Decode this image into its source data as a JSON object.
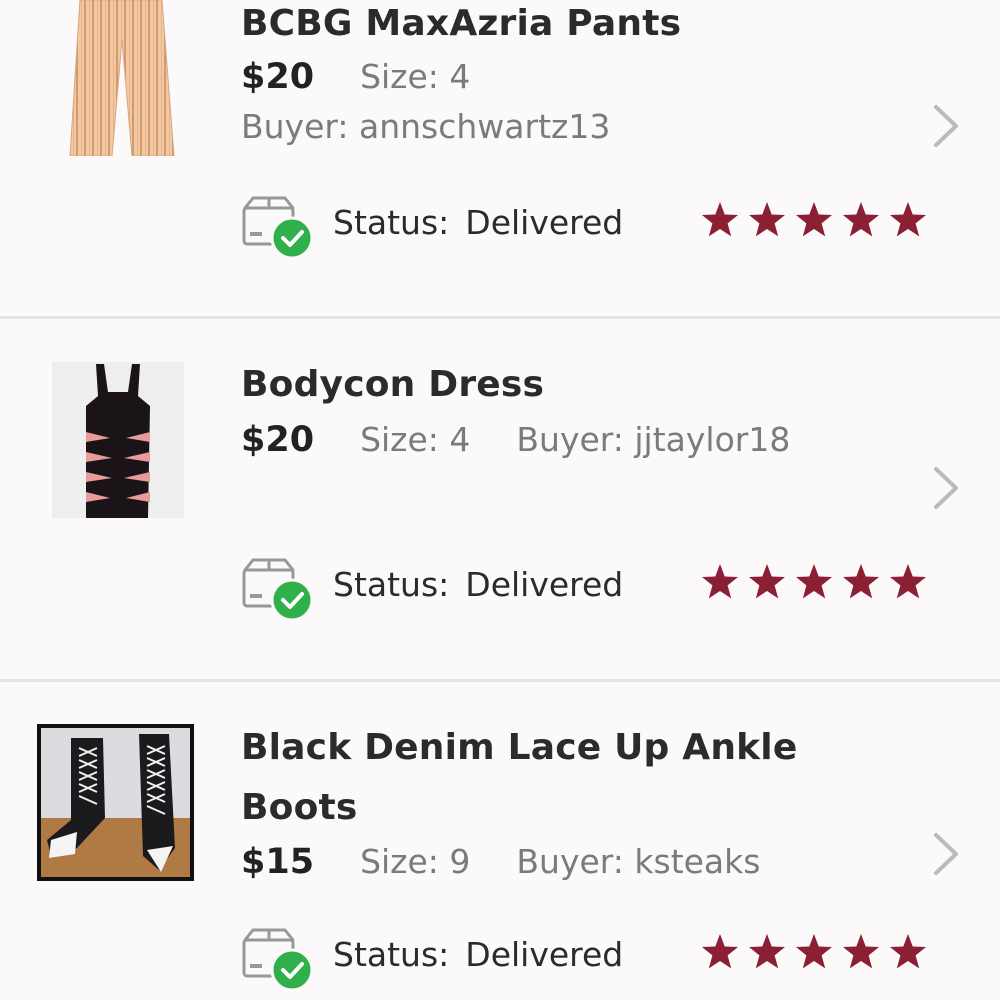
{
  "items": [
    {
      "title_lines": [
        "BCBG MaxAzria Pants"
      ],
      "price": "$20",
      "size": "Size: 4",
      "buyer": "Buyer: annschwartz13",
      "status_label": "Status:",
      "status_value": "Delivered",
      "rating": 5,
      "thumbnail": "striped-pants-photo"
    },
    {
      "title_lines": [
        "Bodycon Dress"
      ],
      "price": "$20",
      "size": "Size: 4",
      "buyer": "Buyer: jjtaylor18",
      "status_label": "Status:",
      "status_value": "Delivered",
      "rating": 5,
      "thumbnail": "black-bodycon-dress-photo"
    },
    {
      "title_lines": [
        "Black Denim Lace Up Ankle",
        "Boots"
      ],
      "price": "$15",
      "size": "Size: 9",
      "buyer": "Buyer: ksteaks",
      "status_label": "Status:",
      "status_value": "Delivered",
      "rating": 5,
      "thumbnail": "lace-up-ankle-boots-photo"
    }
  ],
  "colors": {
    "star": "#8b1f33",
    "check_badge": "#2fb04a",
    "divider": "#e6e3e5",
    "chevron": "#bdbabb"
  },
  "icons": {
    "status": "box-delivered-icon",
    "chevron": "chevron-right-icon",
    "rating": "star-icon"
  }
}
